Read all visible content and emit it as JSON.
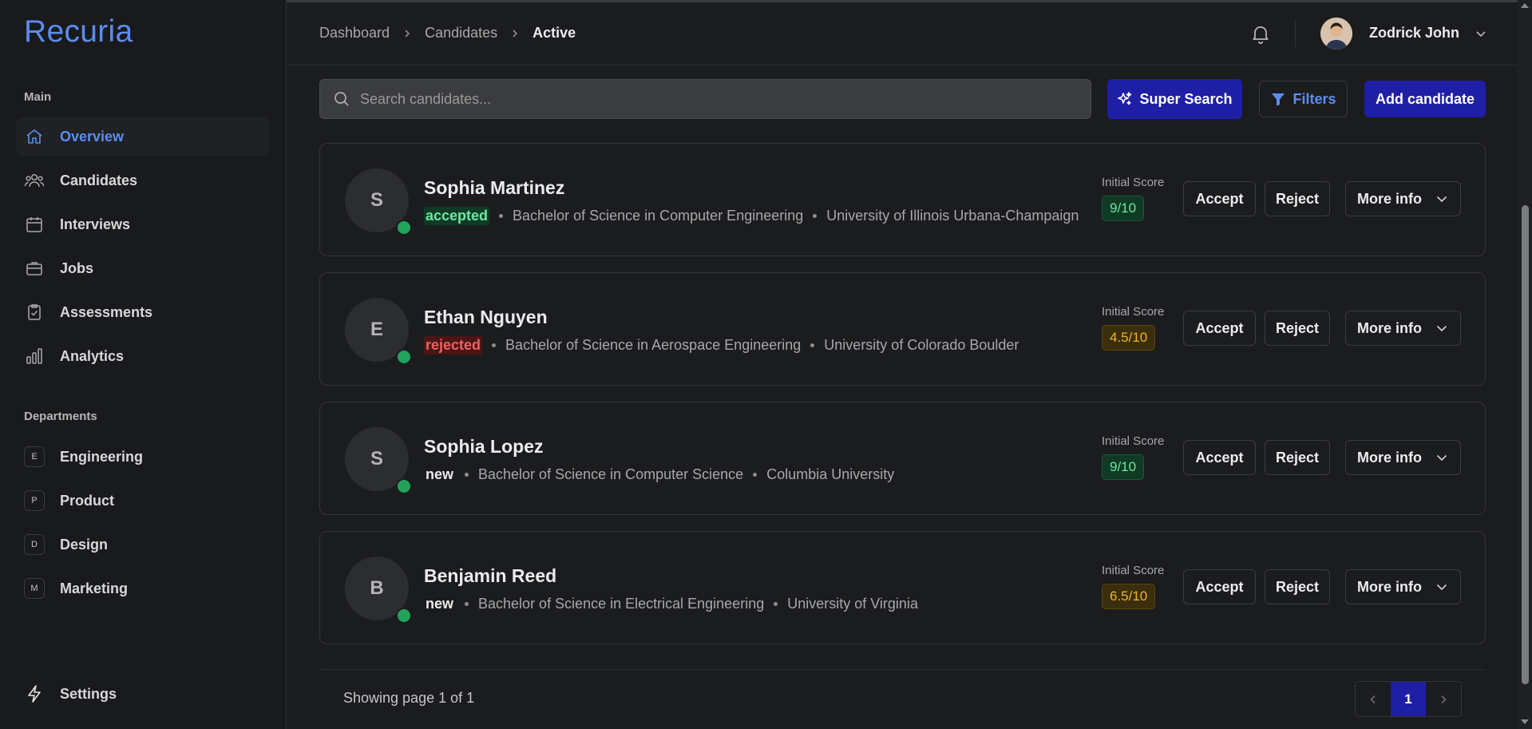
{
  "app": {
    "name": "Recuria"
  },
  "sidebar": {
    "main_title": "Main",
    "items": [
      {
        "label": "Overview",
        "icon": "home-icon"
      },
      {
        "label": "Candidates",
        "icon": "users-icon"
      },
      {
        "label": "Interviews",
        "icon": "calendar-icon"
      },
      {
        "label": "Jobs",
        "icon": "briefcase-icon"
      },
      {
        "label": "Assessments",
        "icon": "clipboard-check-icon"
      },
      {
        "label": "Analytics",
        "icon": "bar-chart-icon"
      }
    ],
    "departments_title": "Departments",
    "departments": [
      {
        "badge": "E",
        "label": "Engineering"
      },
      {
        "badge": "P",
        "label": "Product"
      },
      {
        "badge": "D",
        "label": "Design"
      },
      {
        "badge": "M",
        "label": "Marketing"
      }
    ],
    "settings_label": "Settings"
  },
  "header": {
    "breadcrumb": [
      "Dashboard",
      "Candidates",
      "Active"
    ],
    "user_name": "Zodrick John"
  },
  "toolbar": {
    "search_placeholder": "Search candidates...",
    "super_search_label": "Super Search",
    "filters_label": "Filters",
    "add_label": "Add candidate"
  },
  "candidates": [
    {
      "initial": "S",
      "name": "Sophia Martinez",
      "status": "accepted",
      "degree": "Bachelor of Science in Computer Engineering",
      "school": "University of Illinois Urbana-Champaign",
      "score_label": "Initial Score",
      "score": "9/10",
      "score_color": "#6ee7a0"
    },
    {
      "initial": "E",
      "name": "Ethan Nguyen",
      "status": "rejected",
      "degree": "Bachelor of Science in Aerospace Engineering",
      "school": "University of Colorado Boulder",
      "score_label": "Initial Score",
      "score": "4.5/10",
      "score_color": "#f0b429"
    },
    {
      "initial": "S",
      "name": "Sophia Lopez",
      "status": "new",
      "degree": "Bachelor of Science in Computer Science",
      "school": "Columbia University",
      "score_label": "Initial Score",
      "score": "9/10",
      "score_color": "#6ee7a0"
    },
    {
      "initial": "B",
      "name": "Benjamin Reed",
      "status": "new",
      "degree": "Bachelor of Science in Electrical Engineering",
      "school": "University of Virginia",
      "score_label": "Initial Score",
      "score": "6.5/10",
      "score_color": "#f0b429"
    }
  ],
  "card_actions": {
    "accept": "Accept",
    "reject": "Reject",
    "more": "More info"
  },
  "pagination": {
    "info": "Showing page 1 of 1",
    "current": "1"
  },
  "colors": {
    "accent": "#5b8def",
    "primary_button": "#1f1fa6",
    "online": "#22a35a"
  }
}
